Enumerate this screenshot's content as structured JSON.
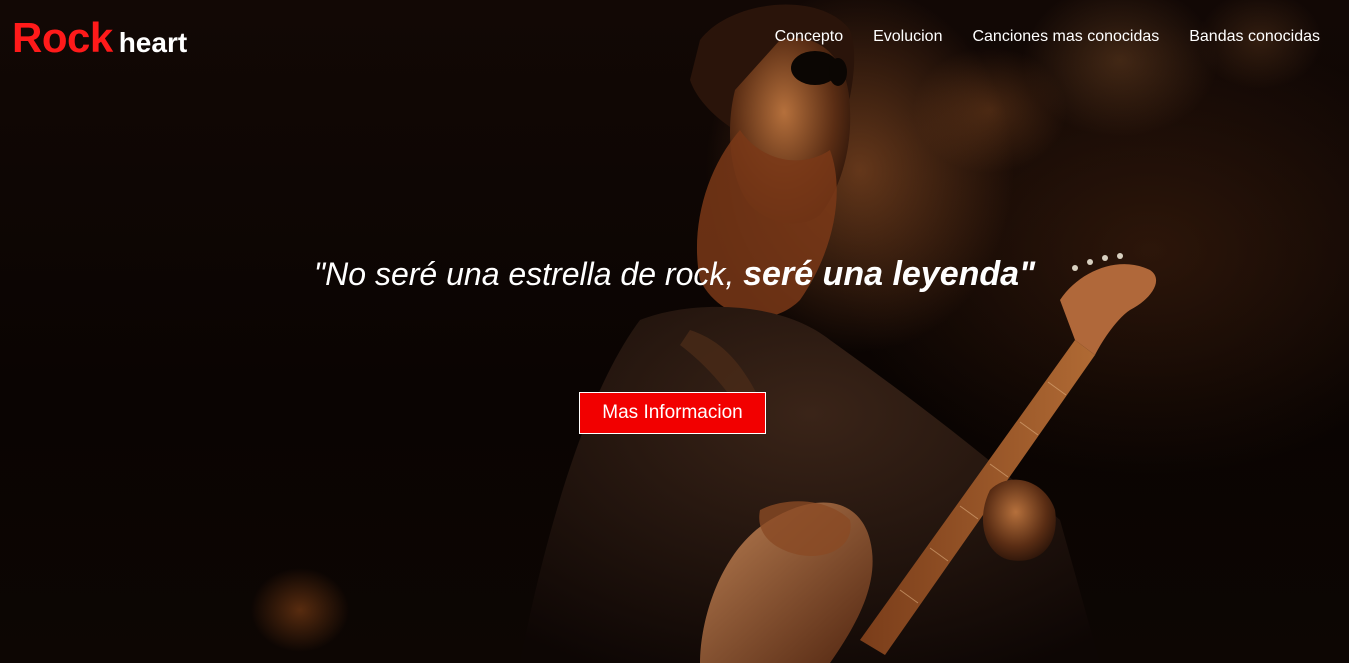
{
  "brand": {
    "name_primary": "Rock",
    "name_secondary": "heart",
    "accent_color": "#f20000"
  },
  "nav": {
    "items": [
      {
        "label": "Concepto"
      },
      {
        "label": "Evolucion"
      },
      {
        "label": "Canciones mas conocidas"
      },
      {
        "label": "Bandas conocidas"
      }
    ]
  },
  "hero": {
    "quote_regular": "\"No seré una estrella de rock, ",
    "quote_bold": "seré una leyenda\"",
    "cta_label": "Mas Informacion",
    "background": "guitarist-photo"
  }
}
